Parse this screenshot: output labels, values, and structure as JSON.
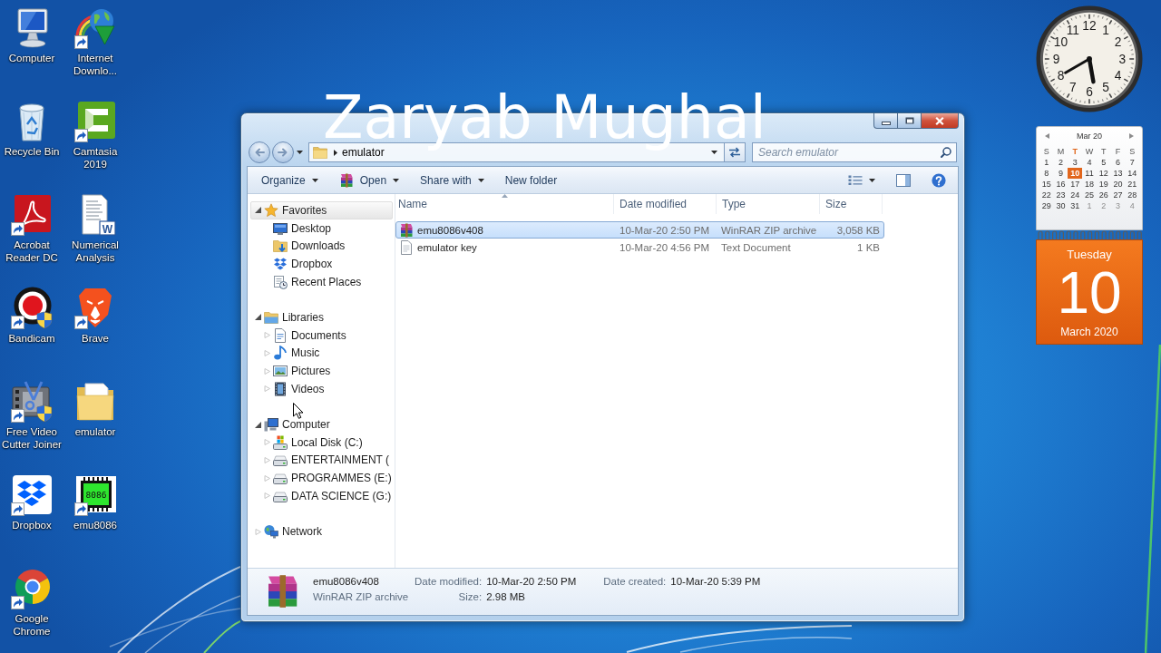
{
  "desktop": {
    "icons": [
      {
        "label": "Computer",
        "kind": "computer",
        "shortcut": false
      },
      {
        "label": "Recycle Bin",
        "kind": "recycle-bin",
        "shortcut": false
      },
      {
        "label": "Acrobat Reader DC",
        "kind": "pdf-reader",
        "shortcut": true
      },
      {
        "label": "Bandicam",
        "kind": "screen-recorder",
        "shortcut": true
      },
      {
        "label": "Free Video Cutter Joiner",
        "kind": "video-cutter",
        "shortcut": true
      },
      {
        "label": "Dropbox",
        "kind": "cloud-storage",
        "shortcut": true
      },
      {
        "label": "Google Chrome",
        "kind": "browser",
        "shortcut": true
      },
      {
        "label": "Internet Downlo...",
        "kind": "downloader",
        "shortcut": true
      },
      {
        "label": "Camtasia 2019",
        "kind": "screen-editor",
        "shortcut": true
      },
      {
        "label": "Numerical Analysis",
        "kind": "word-document",
        "shortcut": false,
        "icon_text": "W"
      },
      {
        "label": "Brave",
        "kind": "lion-browser",
        "shortcut": true
      },
      {
        "label": "emulator",
        "kind": "folder",
        "shortcut": false
      },
      {
        "label": "emu8086",
        "kind": "chip",
        "shortcut": true,
        "icon_text": "8086"
      }
    ],
    "caption": "Zaryab Mughal"
  },
  "explorer": {
    "address": {
      "segments": [
        "emulator"
      ]
    },
    "search": {
      "placeholder": "Search emulator"
    },
    "toolbar": [
      {
        "label": "Organize",
        "kind": "menu"
      },
      {
        "label": "Open",
        "kind": "app-menu"
      },
      {
        "label": "Share with",
        "kind": "menu"
      },
      {
        "label": "New folder",
        "kind": "plain"
      }
    ],
    "nav_pane": [
      {
        "label": "Favorites",
        "kind": "favorites",
        "expanded": true,
        "selected": true,
        "children": [
          {
            "label": "Desktop",
            "kind": "desktop",
            "selected": false
          },
          {
            "label": "Downloads",
            "kind": "downloads",
            "selected": false
          },
          {
            "label": "Dropbox",
            "kind": "cloud-storage",
            "selected": false
          },
          {
            "label": "Recent Places",
            "kind": "recent",
            "selected": false
          }
        ]
      },
      {
        "label": "Libraries",
        "kind": "libraries",
        "expanded": true,
        "selected": false,
        "children": [
          {
            "label": "Documents",
            "kind": "documents",
            "expanded": false,
            "selected": false
          },
          {
            "label": "Music",
            "kind": "music",
            "expanded": false,
            "selected": false
          },
          {
            "label": "Pictures",
            "kind": "pictures",
            "expanded": false,
            "selected": false
          },
          {
            "label": "Videos",
            "kind": "videos",
            "expanded": false,
            "selected": false
          }
        ]
      },
      {
        "label": "Computer",
        "kind": "computer",
        "expanded": true,
        "selected": false,
        "children": [
          {
            "label": "Local Disk (C:)",
            "kind": "system-drive",
            "expanded": false,
            "selected": false
          },
          {
            "label": "ENTERTAINMENT (",
            "kind": "drive",
            "expanded": false,
            "selected": false
          },
          {
            "label": "PROGRAMMES (E:)",
            "kind": "drive",
            "expanded": false,
            "selected": false
          },
          {
            "label": "DATA SCIENCE (G:)",
            "kind": "drive",
            "expanded": false,
            "selected": false
          }
        ]
      },
      {
        "label": "Network",
        "kind": "network",
        "expanded": false,
        "selected": false
      }
    ],
    "file_list": {
      "columns": [
        {
          "label": "Name",
          "sorted": true
        },
        {
          "label": "Date modified",
          "sorted": false
        },
        {
          "label": "Type",
          "sorted": false
        },
        {
          "label": "Size",
          "sorted": false
        }
      ],
      "rows": [
        {
          "kind": "archive",
          "name": "emu8086v408",
          "date_modified": "10-Mar-20 2:50 PM",
          "type": "WinRAR ZIP archive",
          "size": "3,058 KB",
          "selected": true
        },
        {
          "kind": "text",
          "name": "emulator key",
          "date_modified": "10-Mar-20 4:56 PM",
          "type": "Text Document",
          "size": "1 KB",
          "selected": false
        }
      ]
    },
    "details_pane": {
      "kind": "archive",
      "name": "emu8086v408",
      "type": "WinRAR ZIP archive",
      "field_groups": [
        [
          {
            "label": "Date modified:",
            "value": "10-Mar-20 2:50 PM"
          },
          {
            "label": "Size:",
            "value": "2.98 MB"
          }
        ],
        [
          {
            "label": "Date created:",
            "value": "10-Mar-20 5:39 PM"
          }
        ]
      ]
    }
  },
  "gadgets": {
    "clock": {
      "numerals": [
        "11",
        "12",
        "1",
        "10",
        "2",
        "9",
        "3",
        "8",
        "4",
        "7",
        "5",
        "6"
      ]
    },
    "calendar": {
      "month": "Mar 20",
      "weekdays": [
        {
          "label": "S",
          "today": false
        },
        {
          "label": "M",
          "today": false
        },
        {
          "label": "T",
          "today": true
        },
        {
          "label": "W",
          "today": false
        },
        {
          "label": "T",
          "today": false
        },
        {
          "label": "F",
          "today": false
        },
        {
          "label": "S",
          "today": false
        }
      ],
      "days": [
        {
          "label": "1",
          "today": false,
          "dimmed": false
        },
        {
          "label": "2",
          "today": false,
          "dimmed": false
        },
        {
          "label": "3",
          "today": false,
          "dimmed": false
        },
        {
          "label": "4",
          "today": false,
          "dimmed": false
        },
        {
          "label": "5",
          "today": false,
          "dimmed": false
        },
        {
          "label": "6",
          "today": false,
          "dimmed": false
        },
        {
          "label": "7",
          "today": false,
          "dimmed": false
        },
        {
          "label": "8",
          "today": false,
          "dimmed": false
        },
        {
          "label": "9",
          "today": false,
          "dimmed": false
        },
        {
          "label": "10",
          "today": true,
          "dimmed": false
        },
        {
          "label": "11",
          "today": false,
          "dimmed": false
        },
        {
          "label": "12",
          "today": false,
          "dimmed": false
        },
        {
          "label": "13",
          "today": false,
          "dimmed": false
        },
        {
          "label": "14",
          "today": false,
          "dimmed": false
        },
        {
          "label": "15",
          "today": false,
          "dimmed": false
        },
        {
          "label": "16",
          "today": false,
          "dimmed": false
        },
        {
          "label": "17",
          "today": false,
          "dimmed": false
        },
        {
          "label": "18",
          "today": false,
          "dimmed": false
        },
        {
          "label": "19",
          "today": false,
          "dimmed": false
        },
        {
          "label": "20",
          "today": false,
          "dimmed": false
        },
        {
          "label": "21",
          "today": false,
          "dimmed": false
        },
        {
          "label": "22",
          "today": false,
          "dimmed": false
        },
        {
          "label": "23",
          "today": false,
          "dimmed": false
        },
        {
          "label": "24",
          "today": false,
          "dimmed": false
        },
        {
          "label": "25",
          "today": false,
          "dimmed": false
        },
        {
          "label": "26",
          "today": false,
          "dimmed": false
        },
        {
          "label": "27",
          "today": false,
          "dimmed": false
        },
        {
          "label": "28",
          "today": false,
          "dimmed": false
        },
        {
          "label": "29",
          "today": false,
          "dimmed": false
        },
        {
          "label": "30",
          "today": false,
          "dimmed": false
        },
        {
          "label": "31",
          "today": false,
          "dimmed": false
        },
        {
          "label": "1",
          "today": false,
          "dimmed": true
        },
        {
          "label": "2",
          "today": false,
          "dimmed": true
        },
        {
          "label": "3",
          "today": false,
          "dimmed": true
        },
        {
          "label": "4",
          "today": false,
          "dimmed": true
        }
      ],
      "page": {
        "weekday": "Tuesday",
        "day": "10",
        "month": "March 2020"
      }
    }
  }
}
